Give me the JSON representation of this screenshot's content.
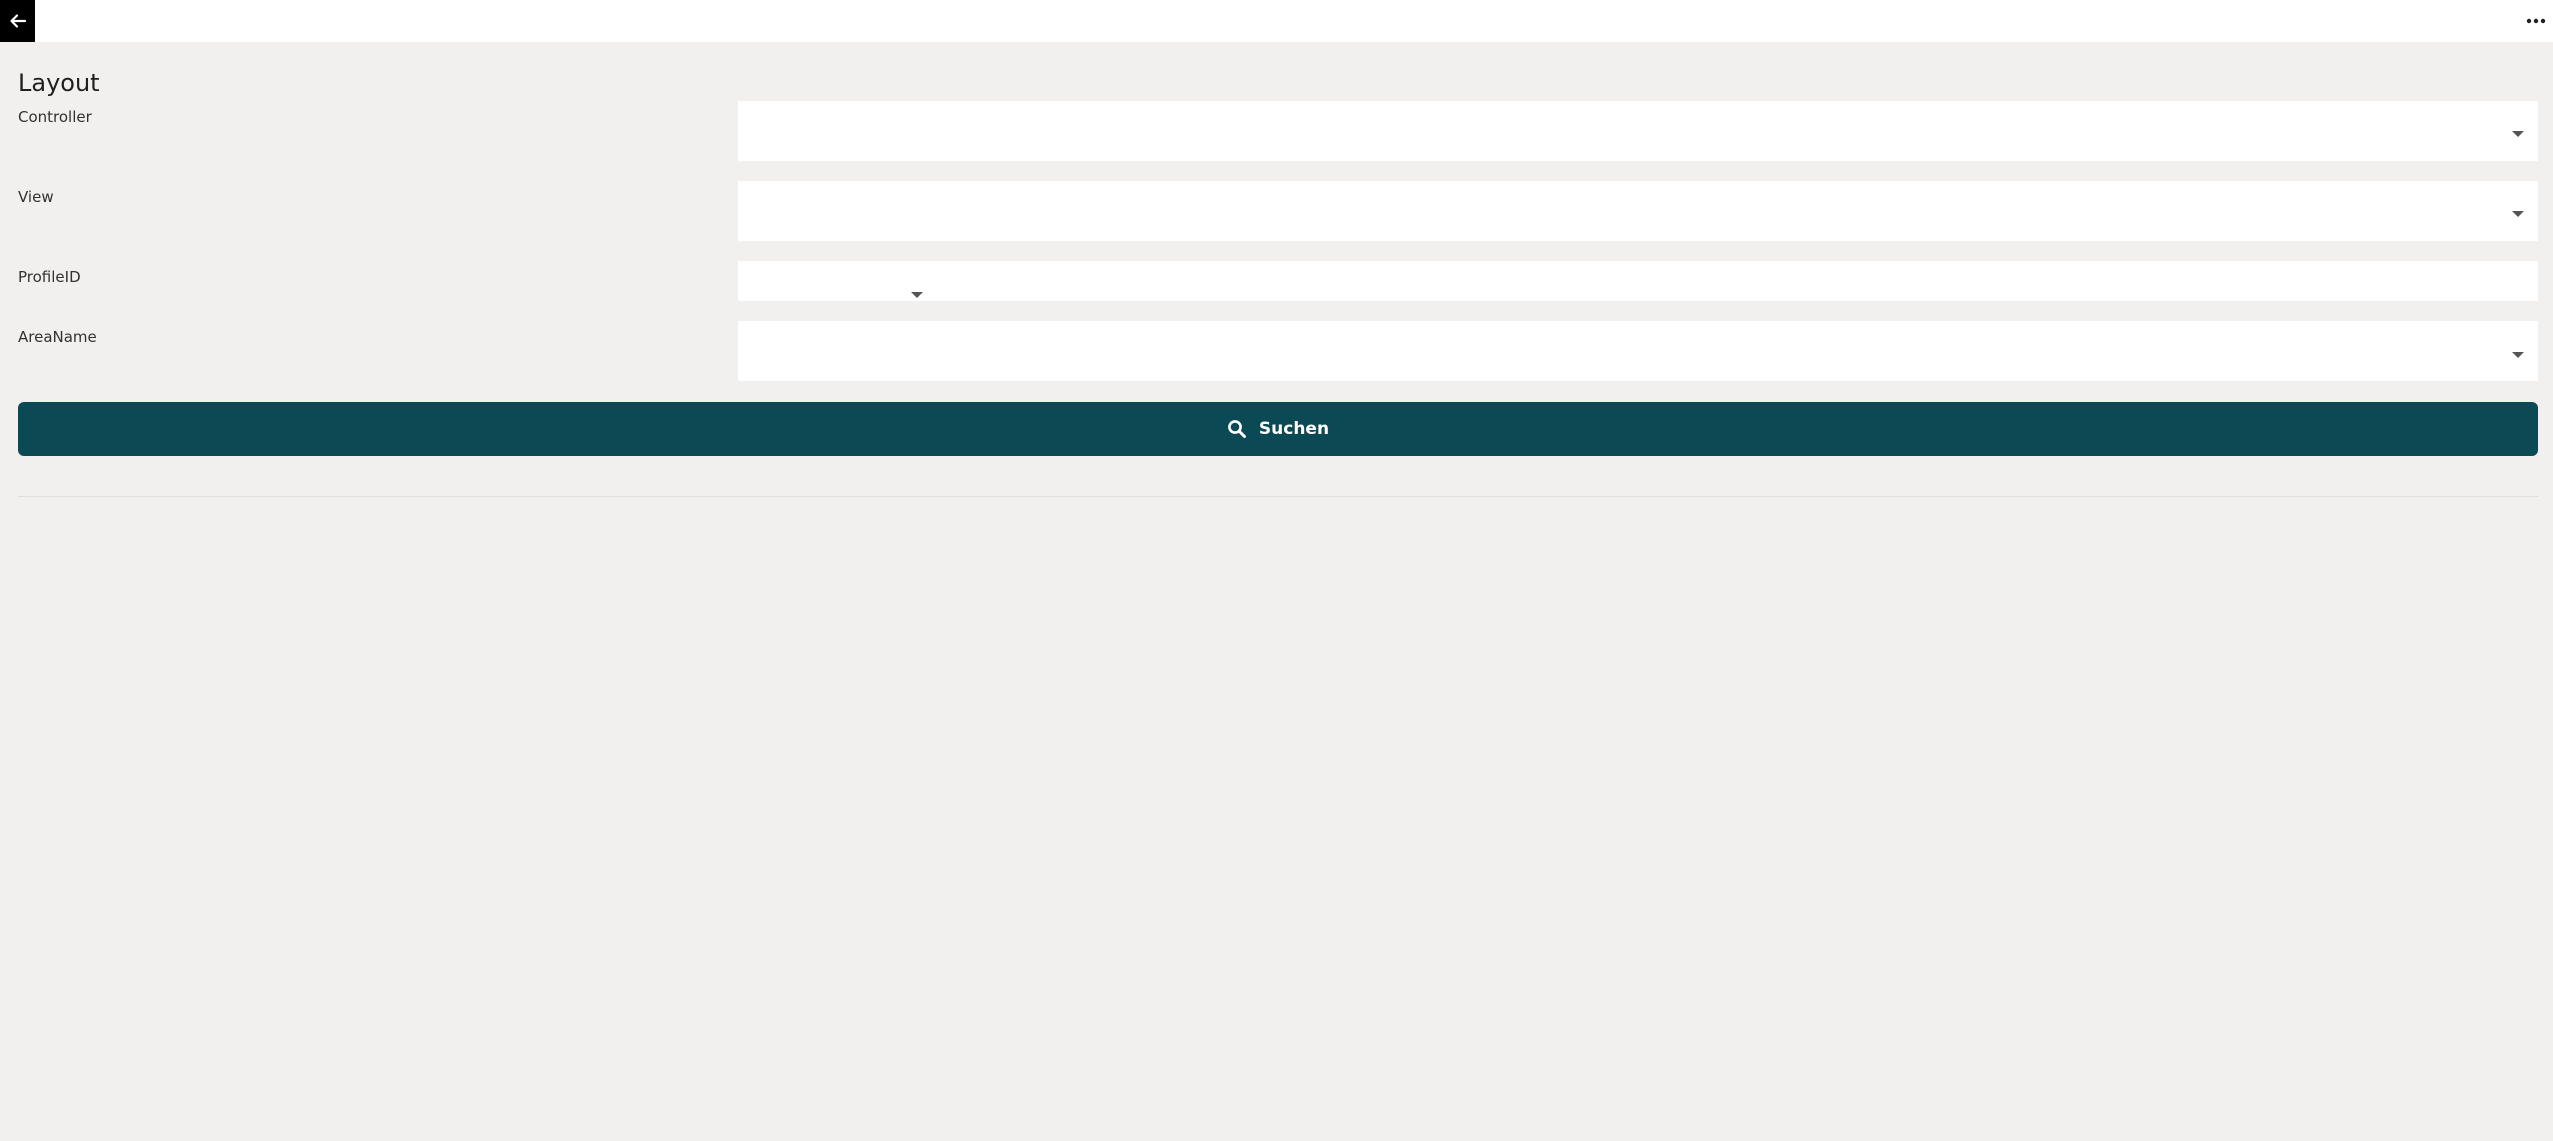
{
  "header": {
    "back_icon": "arrow-left-icon",
    "more_icon": "more-horizontal-icon"
  },
  "page": {
    "title": "Layout"
  },
  "form": {
    "fields": [
      {
        "label": "Controller",
        "value": ""
      },
      {
        "label": "View",
        "value": ""
      },
      {
        "label": "ProfileID",
        "value": ""
      },
      {
        "label": "AreaName",
        "value": ""
      }
    ]
  },
  "actions": {
    "search_label": "Suchen",
    "search_icon": "search-icon"
  },
  "colors": {
    "primary": "#0b4a55",
    "background": "#f1f0ee",
    "surface": "#ffffff",
    "back_button": "#000000"
  }
}
